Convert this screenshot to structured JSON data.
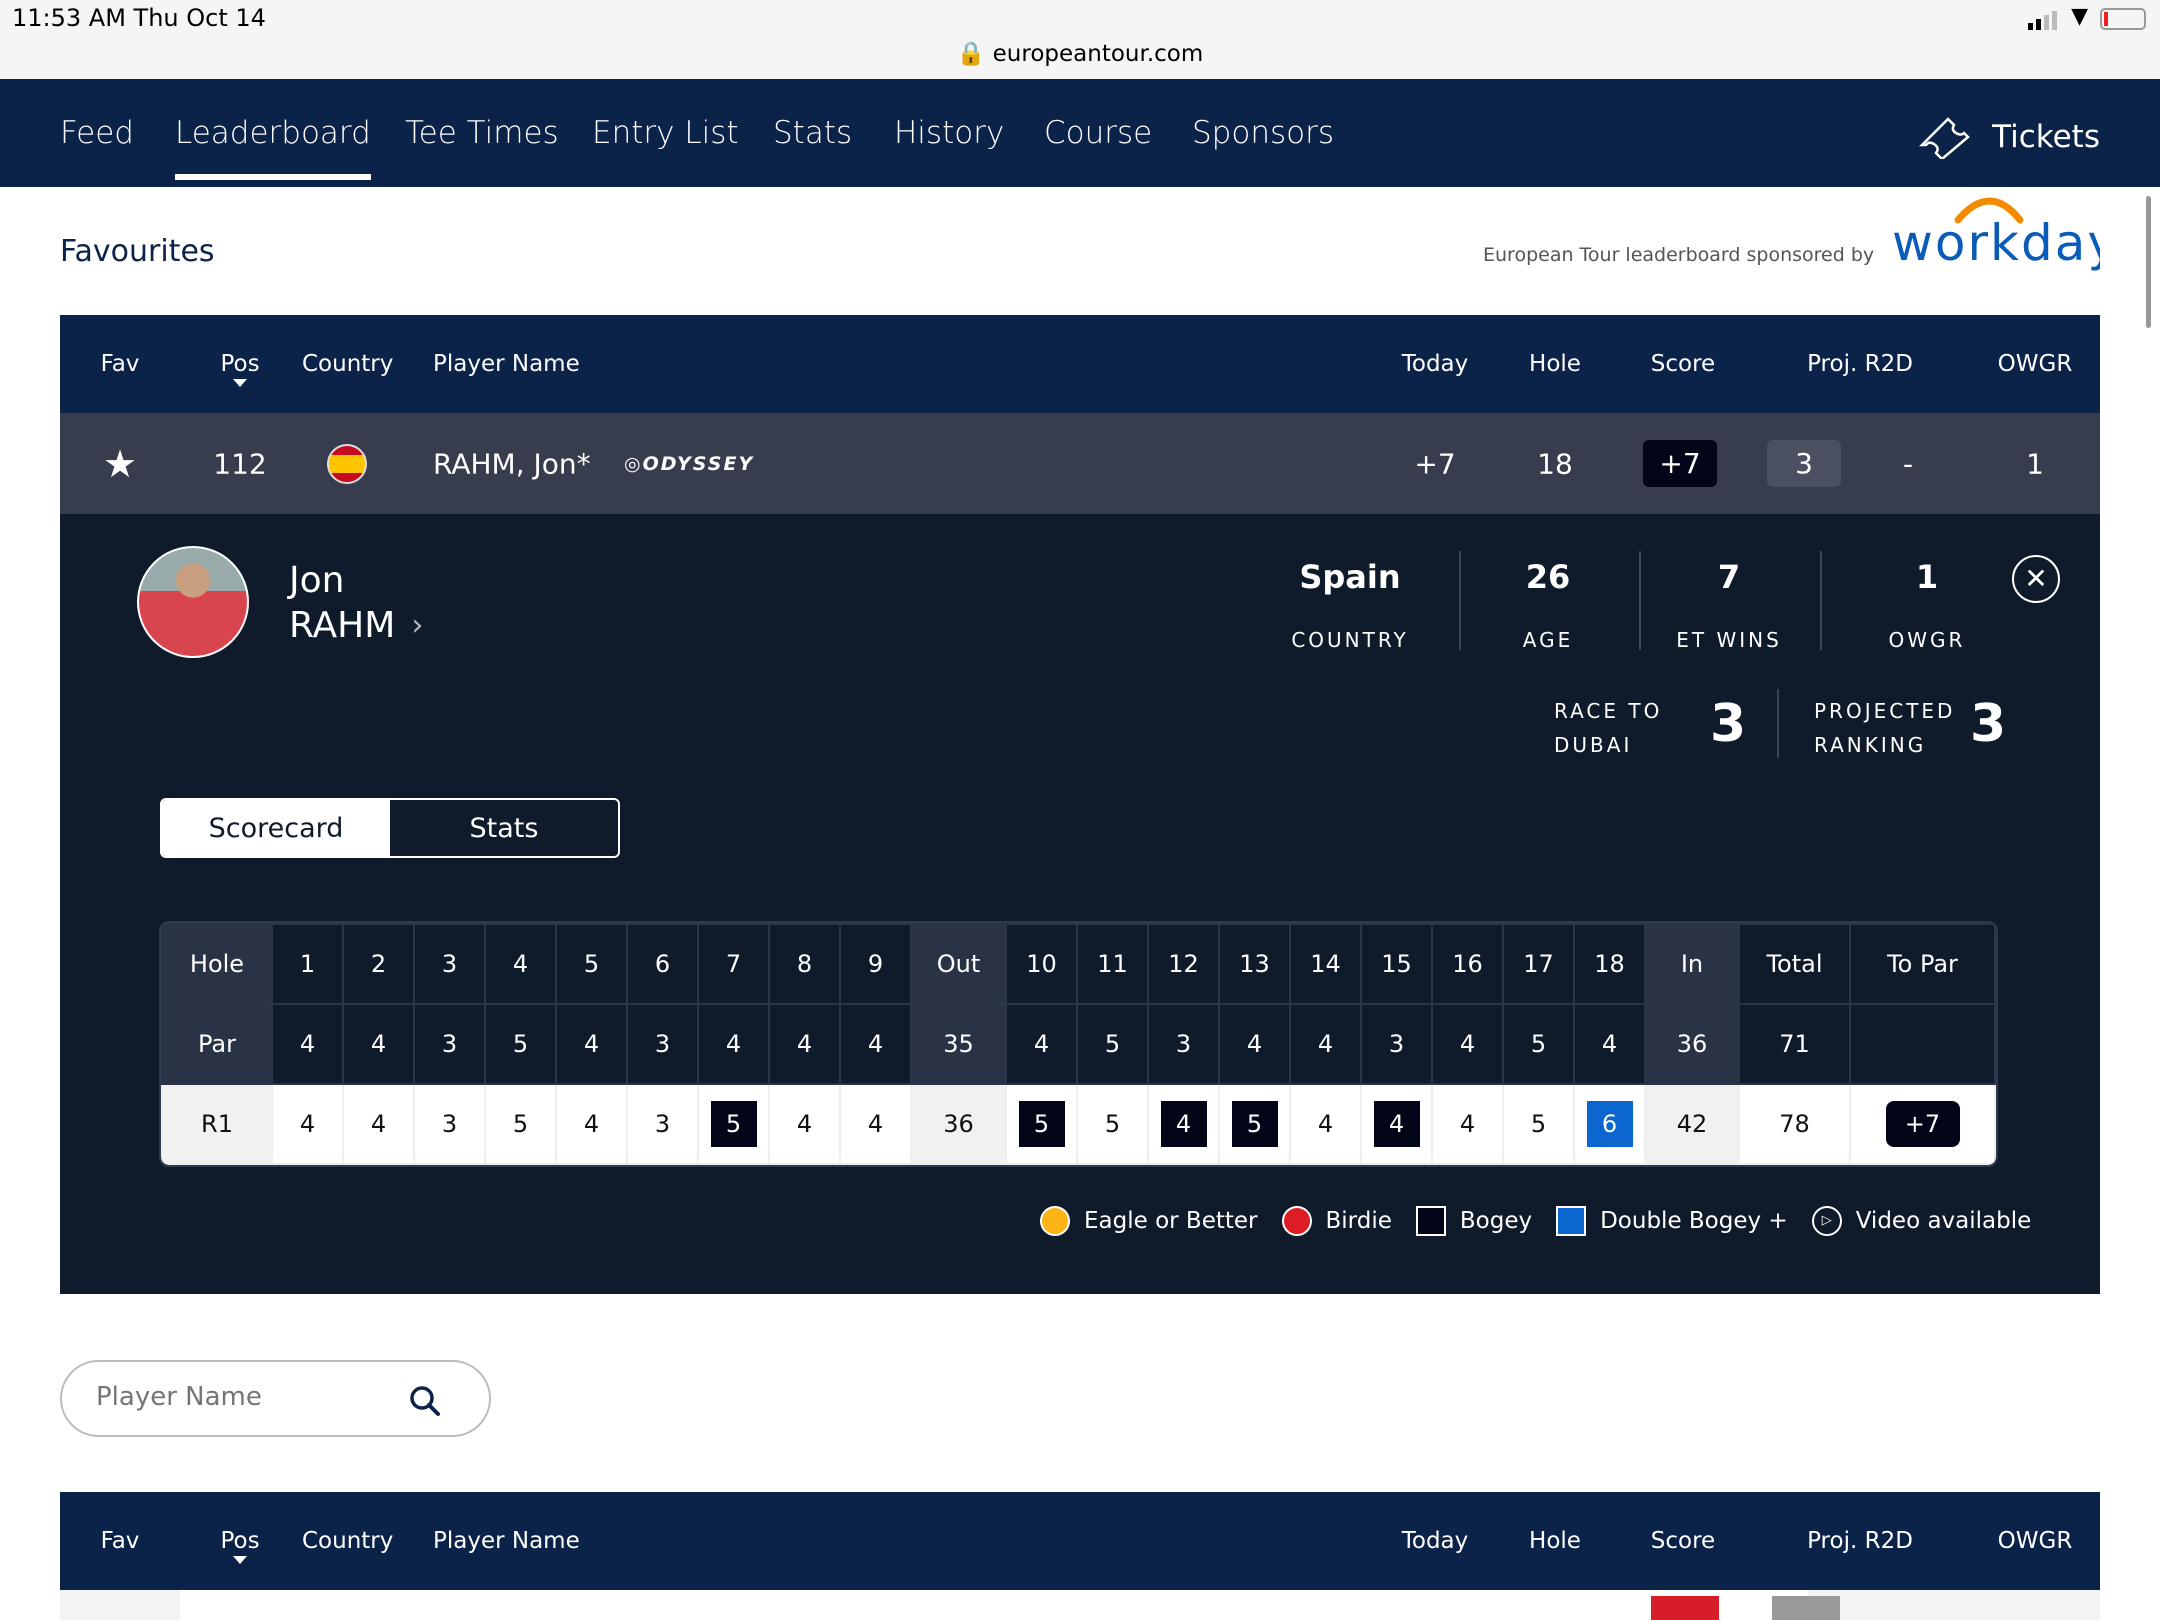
{
  "status": {
    "time": "11:53 AM   Thu Oct 14",
    "url": "europeantour.com"
  },
  "nav": {
    "items": [
      "Feed",
      "Leaderboard",
      "Tee Times",
      "Entry List",
      "Stats",
      "History",
      "Course",
      "Sponsors"
    ],
    "active": "Leaderboard",
    "tickets": "Tickets"
  },
  "favourites": {
    "title": "Favourites",
    "sponsor_text": "European Tour leaderboard sponsored by",
    "sponsor_logo": "workday."
  },
  "columns": {
    "fav": "Fav",
    "pos": "Pos",
    "country": "Country",
    "player": "Player Name",
    "today": "Today",
    "hole": "Hole",
    "score": "Score",
    "proj": "Proj. R2D",
    "owgr": "OWGR"
  },
  "player_row": {
    "pos": "112",
    "name": "RAHM, Jon*",
    "sponsor": "ODYSSEY",
    "today": "+7",
    "hole": "18",
    "score": "+7",
    "proj_badge": "3",
    "proj": "-",
    "owgr": "1"
  },
  "profile": {
    "first": "Jon",
    "last": "RAHM",
    "country": "Spain",
    "country_label": "COUNTRY",
    "age": "26",
    "age_label": "AGE",
    "wins": "7",
    "wins_label": "ET WINS",
    "owgr": "1",
    "owgr_label": "OWGR",
    "r2d_label1": "RACE TO",
    "r2d_label2": "DUBAI",
    "r2d": "3",
    "proj_label1": "PROJECTED",
    "proj_label2": "RANKING",
    "proj": "3"
  },
  "tabs": {
    "scorecard": "Scorecard",
    "stats": "Stats"
  },
  "scorecard": {
    "hole_label": "Hole",
    "par_label": "Par",
    "round_label": "R1",
    "holes": [
      "1",
      "2",
      "3",
      "4",
      "5",
      "6",
      "7",
      "8",
      "9",
      "Out",
      "10",
      "11",
      "12",
      "13",
      "14",
      "15",
      "16",
      "17",
      "18",
      "In",
      "Total",
      "To Par"
    ],
    "par": [
      "4",
      "4",
      "3",
      "5",
      "4",
      "3",
      "4",
      "4",
      "4",
      "35",
      "4",
      "5",
      "3",
      "4",
      "4",
      "3",
      "4",
      "5",
      "4",
      "36",
      "71",
      ""
    ],
    "r1": [
      "4",
      "4",
      "3",
      "5",
      "4",
      "3",
      "5",
      "4",
      "4",
      "36",
      "5",
      "5",
      "4",
      "5",
      "4",
      "4",
      "4",
      "5",
      "6",
      "42",
      "78",
      "+7"
    ],
    "r1_type": [
      "",
      "",
      "",
      "",
      "",
      "",
      "bogey",
      "",
      "",
      "",
      "bogey",
      "",
      "bogey",
      "bogey",
      "",
      "bogey",
      "",
      "",
      "dbl",
      "",
      "",
      "topar"
    ]
  },
  "legend": [
    {
      "label": "Eagle or Better",
      "color": "#fbb316"
    },
    {
      "label": "Birdie",
      "color": "#dd1c24"
    },
    {
      "label": "Bogey",
      "color": "#020418"
    },
    {
      "label": "Double Bogey +",
      "color": "#0b66d0"
    },
    {
      "label": "Video available"
    }
  ],
  "search": {
    "placeholder": "Player Name"
  }
}
